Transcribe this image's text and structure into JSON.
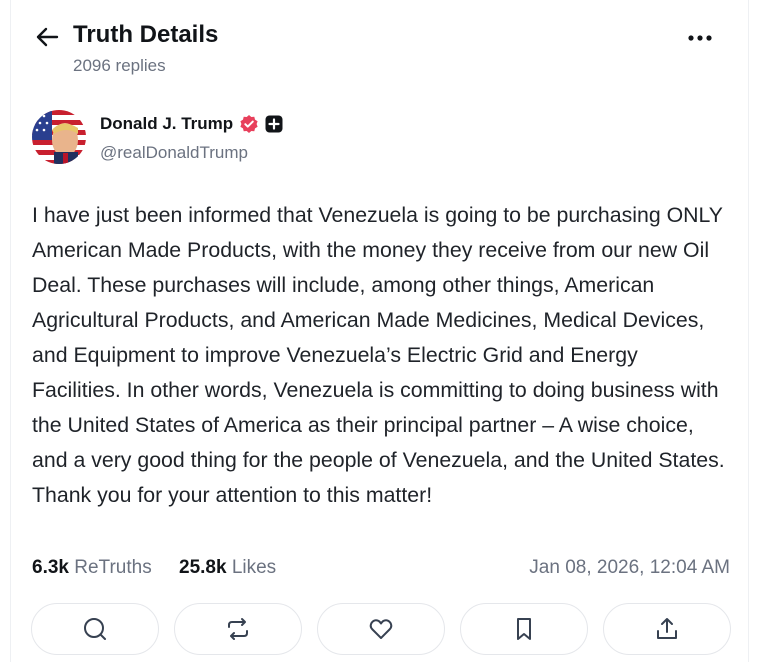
{
  "header": {
    "title": "Truth Details",
    "replies": "2096 replies"
  },
  "author": {
    "name": "Donald J. Trump",
    "handle": "@realDonaldTrump"
  },
  "post": {
    "text": "I have just been informed that Venezuela is going to be purchasing ONLY American Made Products, with the money they receive from our new Oil Deal. These purchases will include, among other things, American Agricultural Products, and American Made Medicines, Medical Devices, and Equipment to improve Venezuela’s Electric Grid and Energy Facilities. In other words, Venezuela is committing to doing business with the United States of America as their principal partner – A wise choice, and a very good thing for the people of Venezuela, and the United States. Thank you for your attention to this matter!",
    "retruths_count": "6.3k",
    "retruths_label": "ReTruths",
    "likes_count": "25.8k",
    "likes_label": "Likes",
    "timestamp": "Jan 08, 2026, 12:04 AM"
  },
  "icons": {
    "back": "arrow-left-icon",
    "more": "more-horizontal-icon",
    "verified": "verified-badge-icon",
    "plus": "plus-badge-icon",
    "reply": "reply-icon",
    "retruth": "retruth-icon",
    "like": "heart-icon",
    "bookmark": "bookmark-icon",
    "share": "share-icon"
  },
  "colors": {
    "verified_badge": "#e8405c",
    "muted_text": "#6b7280",
    "border": "#e5e7eb"
  }
}
